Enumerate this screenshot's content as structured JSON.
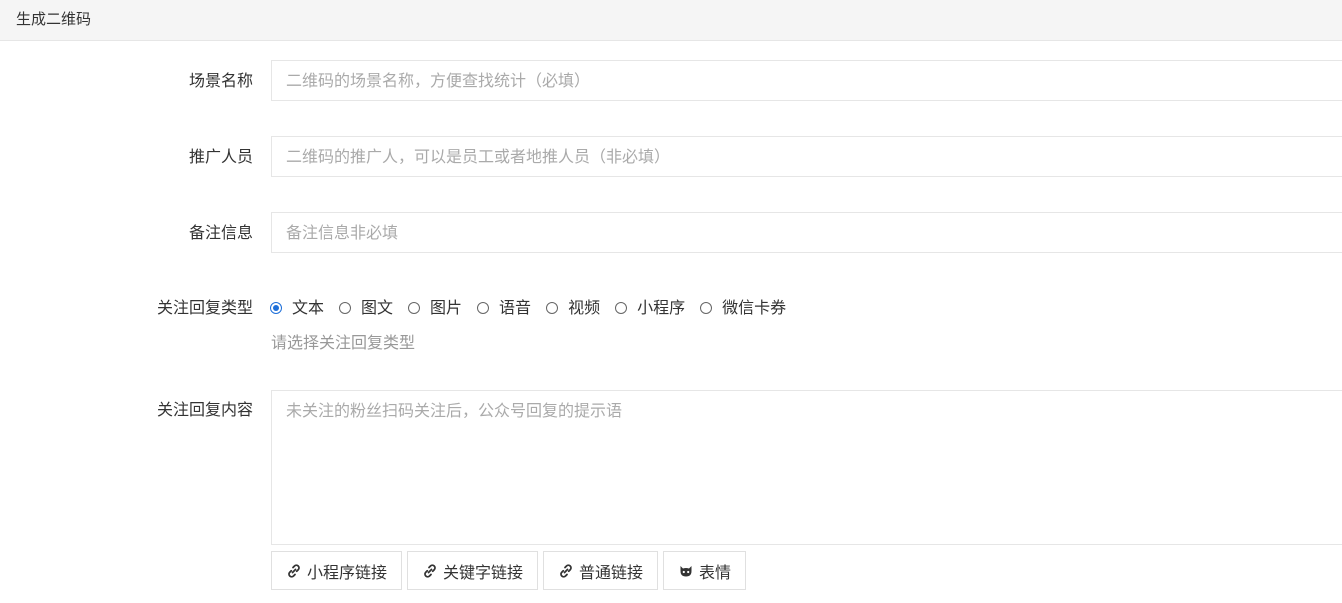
{
  "header": {
    "title": "生成二维码"
  },
  "form": {
    "scene_name": {
      "label": "场景名称",
      "placeholder": "二维码的场景名称，方便查找统计（必填）"
    },
    "promoter": {
      "label": "推广人员",
      "placeholder": "二维码的推广人，可以是员工或者地推人员（非必填）"
    },
    "remark": {
      "label": "备注信息",
      "placeholder": "备注信息非必填"
    },
    "reply_type": {
      "label": "关注回复类型",
      "options": [
        "文本",
        "图文",
        "图片",
        "语音",
        "视频",
        "小程序",
        "微信卡券"
      ],
      "selected": "文本",
      "help": "请选择关注回复类型"
    },
    "reply_content": {
      "label": "关注回复内容",
      "placeholder": "未关注的粉丝扫码关注后，公众号回复的提示语"
    },
    "buttons": [
      {
        "label": "小程序链接",
        "icon": "link-icon"
      },
      {
        "label": "关键字链接",
        "icon": "link-icon"
      },
      {
        "label": "普通链接",
        "icon": "link-icon"
      },
      {
        "label": "表情",
        "icon": "emoji-icon"
      }
    ]
  },
  "colors": {
    "accent": "#1e6fd9",
    "placeholder": "#aaaaaa",
    "border": "#e6e6e6"
  }
}
